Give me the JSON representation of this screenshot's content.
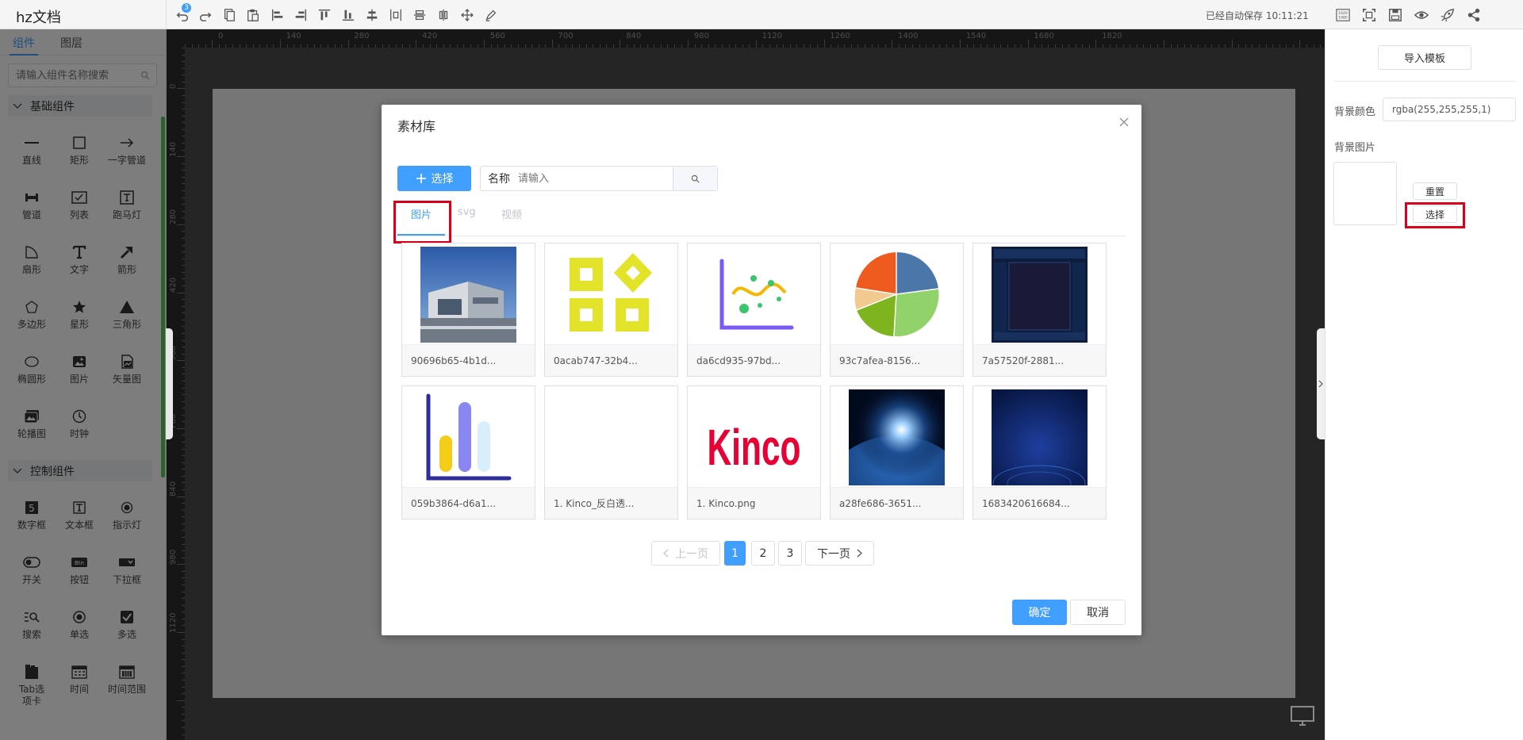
{
  "app": {
    "title": "hz文档",
    "undo_count": "3",
    "save_status": "已经自动保存 10:11:21"
  },
  "toolbar": {
    "icons": [
      "undo-icon",
      "redo-icon",
      "copy-icon",
      "paste-icon",
      "align-left-icon",
      "align-right-icon",
      "align-top-icon",
      "align-bottom-icon",
      "align-vertical-center-icon",
      "distribute-horizontal-icon",
      "distribute-vertical-icon",
      "center-horizontal-icon",
      "move-icon",
      "pen-icon"
    ],
    "right_icons": [
      "resolution-1920x1080-icon",
      "fit-screen-icon",
      "save-icon",
      "preview-icon",
      "publish-rocket-icon",
      "share-icon"
    ]
  },
  "left_panel": {
    "tabs": [
      "组件",
      "图层"
    ],
    "search_placeholder": "请输入组件名称搜索",
    "sections": [
      {
        "title": "基础组件",
        "items": [
          "直线",
          "矩形",
          "一字管道",
          "管道",
          "列表",
          "跑马灯",
          "扇形",
          "文字",
          "箭形",
          "多边形",
          "星形",
          "三角形",
          "椭圆形",
          "图片",
          "矢量图",
          "轮播图",
          "时钟"
        ]
      },
      {
        "title": "控制组件",
        "items": [
          "数字框",
          "文本框",
          "指示灯",
          "开关",
          "按钮",
          "下拉框",
          "搜索",
          "单选",
          "多选",
          "Tab选项卡",
          "时间",
          "时间范围"
        ]
      }
    ]
  },
  "ruler": {
    "top": [
      "0",
      "140",
      "280",
      "420",
      "560",
      "700",
      "840",
      "980",
      "1120",
      "1260",
      "1400",
      "1540",
      "1680",
      "1820"
    ],
    "left": [
      "0",
      "140",
      "280",
      "420",
      "560",
      "700",
      "840",
      "980",
      "1120"
    ]
  },
  "right_panel": {
    "import_button": "导入模板",
    "bg_color_label": "背景颜色",
    "bg_color_value": "rgba(255,255,255,1)",
    "bg_image_label": "背景图片",
    "reset_button": "重置",
    "select_button": "选择"
  },
  "modal": {
    "title": "素材库",
    "select_button": "选择",
    "search_prefix": "名称",
    "search_placeholder": "请输入",
    "tabs": [
      "图片",
      "svg",
      "视频"
    ],
    "active_tab": "图片",
    "items": [
      {
        "caption": "90696b65-4b1d...",
        "thumb": "building-photo"
      },
      {
        "caption": "0acab747-32b4...",
        "thumb": "yellow-squares-logo"
      },
      {
        "caption": "da6cd935-97bd...",
        "thumb": "scatter-chart-icon"
      },
      {
        "caption": "93c7afea-8156...",
        "thumb": "pie-chart-icon"
      },
      {
        "caption": "7a57520f-2881...",
        "thumb": "dark-blue-panel"
      },
      {
        "caption": "059b3864-d6a1...",
        "thumb": "bar-chart-icon"
      },
      {
        "caption": "1. Kinco_反白透...",
        "thumb": "blank-image"
      },
      {
        "caption": "1. Kinco.png",
        "thumb": "kinco-logo",
        "logo_text": "Kinco"
      },
      {
        "caption": "a28fe686-3651...",
        "thumb": "earth-space-photo"
      },
      {
        "caption": "1683420616684...",
        "thumb": "blue-tech-background"
      }
    ],
    "pagination": {
      "prev": "上一页",
      "next": "下一页",
      "pages": [
        "1",
        "2",
        "3"
      ],
      "current": "1"
    },
    "confirm_button": "确定",
    "cancel_button": "取消"
  },
  "colors": {
    "accent": "#409eff",
    "highlight_box": "#d9001b",
    "canvas_bg": "#4a4a4a"
  }
}
